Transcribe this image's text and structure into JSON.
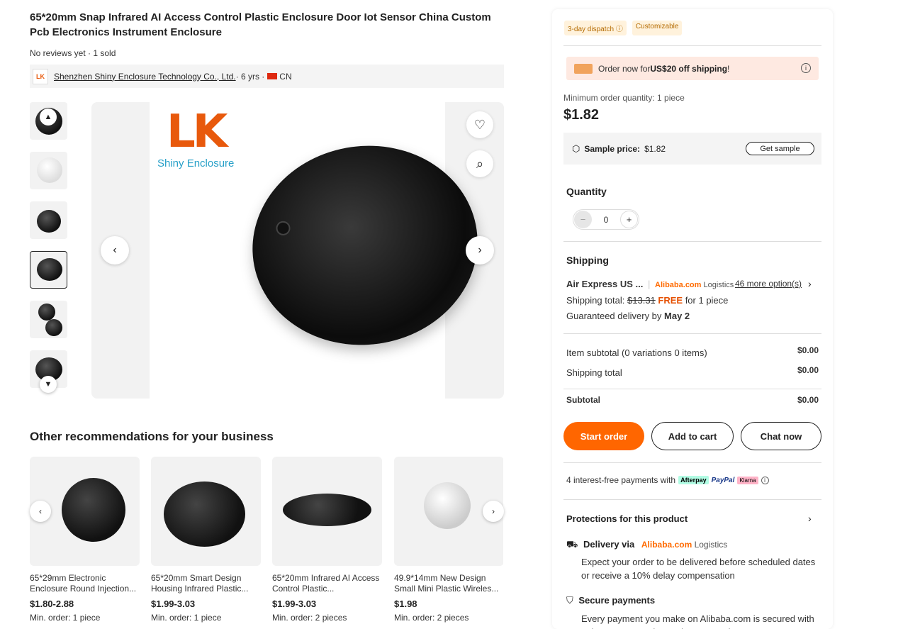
{
  "product": {
    "title": "65*20mm Snap Infrared AI Access Control Plastic Enclosure Door Iot Sensor China Custom Pcb Electronics Instrument Enclosure",
    "meta": "No reviews yet · 1 sold",
    "supplier_logo": "LK",
    "supplier_name": "Shenzhen Shiny Enclosure Technology Co., Ltd.",
    "supplier_years": " · 6 yrs · ",
    "supplier_country": "CN",
    "brand_mark": "LK",
    "brand_text": "Shiny Enclosure"
  },
  "recommendations": {
    "title": "Other recommendations for your business",
    "items": [
      {
        "name": "65*29mm Electronic Enclosure Round Injection...",
        "price": "$1.80-2.88",
        "moq": "Min. order: 1 piece"
      },
      {
        "name": "65*20mm Smart Design Housing Infrared Plastic...",
        "price": "$1.99-3.03",
        "moq": "Min. order: 1 piece"
      },
      {
        "name": "65*20mm Infrared AI Access Control Plastic...",
        "price": "$1.99-3.03",
        "moq": "Min. order: 2 pieces"
      },
      {
        "name": "49.9*14mm New Design Small Mini Plastic Wireles...",
        "price": "$1.98",
        "moq": "Min. order: 2 pieces"
      }
    ]
  },
  "panel": {
    "tag_dispatch": "3-day dispatch ⓘ",
    "tag_custom": "Customizable",
    "promo_prefix": "Order now for ",
    "promo_bold": "US$20 off shipping",
    "promo_suffix": "!",
    "moq": "Minimum order quantity: 1 piece",
    "price": "$1.82",
    "sample_label": "Sample price:",
    "sample_price": "$1.82",
    "get_sample": "Get sample",
    "quantity_label": "Quantity",
    "quantity_value": "0",
    "shipping_label": "Shipping",
    "ship_method": "Air Express US ...",
    "ship_brand": "Alibaba.com",
    "ship_brand_logistics": " Logistics",
    "more_options": "46 more option(s)",
    "ship_total_label": "Shipping total: ",
    "ship_total_old": "$13.31",
    "ship_free": "FREE",
    "ship_total_suffix": " for 1 piece",
    "delivery_prefix": "Guaranteed delivery by ",
    "delivery_date": "May 2",
    "item_subtotal_label": "Item subtotal (0 variations 0 items)",
    "item_subtotal_value": "$0.00",
    "shipping_total_label": "Shipping total",
    "shipping_total_value": "$0.00",
    "subtotal_label": "Subtotal",
    "subtotal_value": "$0.00",
    "start_order": "Start order",
    "add_to_cart": "Add to cart",
    "chat_now": "Chat now",
    "payments_text": "4 interest-free payments with",
    "pay_afterpay": "Afterpay",
    "pay_paypal": "PayPal",
    "pay_klarna": "Klarna",
    "protections": "Protections for this product",
    "delivery_via": "Delivery via",
    "delivery_desc": "Expect your order to be delivered before scheduled dates or receive a 10% delay compensation",
    "secure_payments": "Secure payments",
    "secure_desc": "Every payment you make on Alibaba.com is secured with strict SSL encryption and PCI DSS data"
  },
  "colors": {
    "accent": "#ff6600",
    "free": "#e54f00",
    "promo_bg": "#fee9e1",
    "tag_bg": "#fff2dc"
  }
}
